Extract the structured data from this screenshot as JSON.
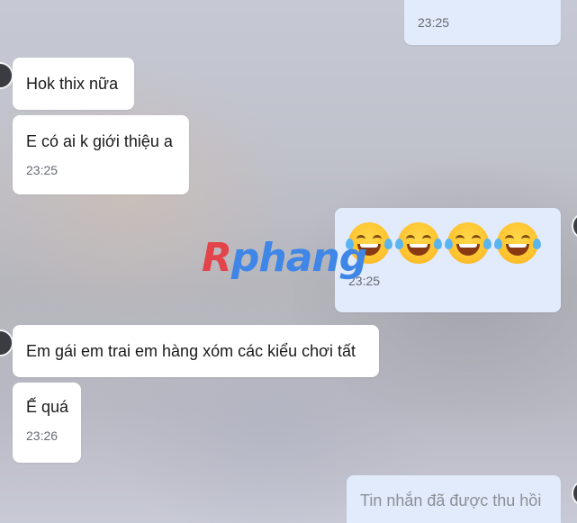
{
  "conversation": {
    "messages": [
      {
        "direction": "sent",
        "text": "",
        "time": "23:25"
      },
      {
        "direction": "received",
        "text": "Hok thix nữa",
        "time": ""
      },
      {
        "direction": "received",
        "text": "E có ai k giới thiệu a",
        "time": "23:25"
      },
      {
        "direction": "sent",
        "emoji": [
          "laugh-cry-emoji",
          "laugh-cry-emoji",
          "laugh-cry-emoji",
          "laugh-cry-emoji"
        ],
        "time": "23:25"
      },
      {
        "direction": "received",
        "text": "Em gái em trai em hàng xóm các kiểu chơi tất",
        "time": ""
      },
      {
        "direction": "received",
        "text": "Ế quá",
        "time": "23:26"
      },
      {
        "direction": "sent",
        "text": "Tin nhắn đã được thu hồi",
        "time": "",
        "recalled": true
      }
    ]
  },
  "watermark": {
    "brand_a": "R",
    "brand_b": "phang"
  },
  "colors": {
    "sent_bubble": "#e1ebfb",
    "received_bubble": "#ffffff",
    "time_text": "#666b73",
    "recalled_text": "#8a8f96"
  }
}
